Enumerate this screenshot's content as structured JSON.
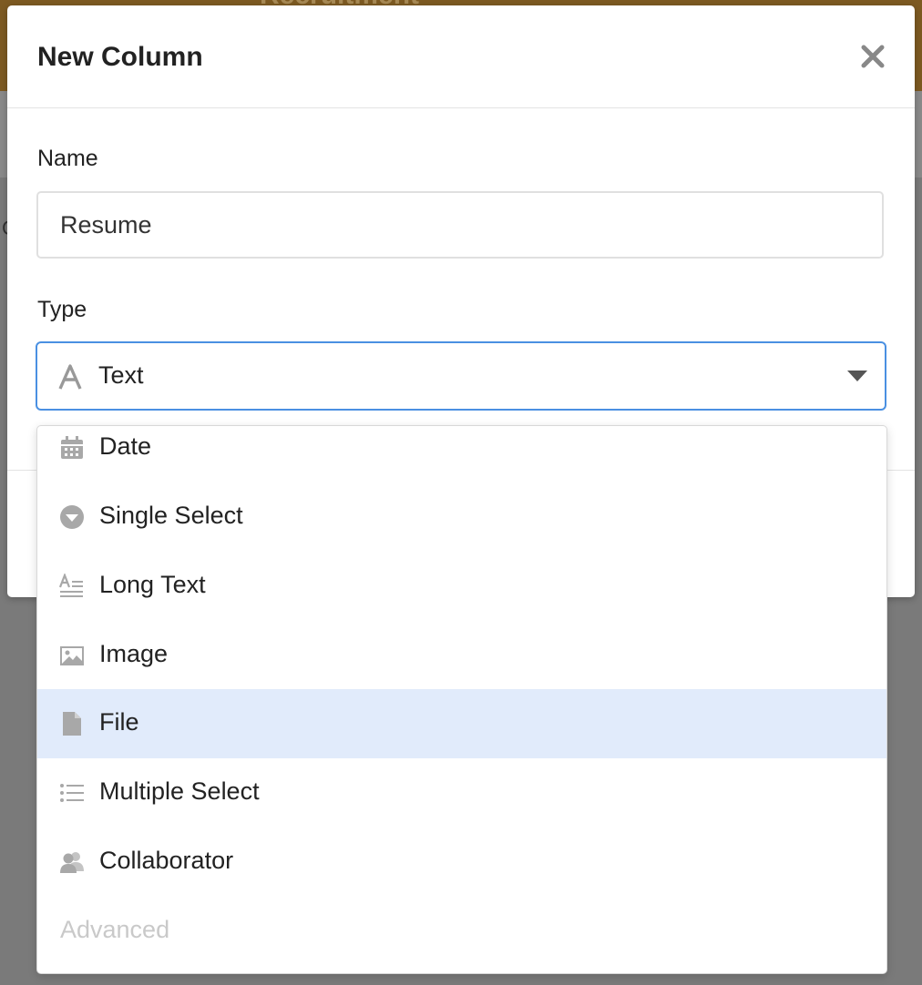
{
  "background": {
    "title_fragment": "Recruitment",
    "letter": "C"
  },
  "modal": {
    "title": "New Column",
    "close_icon": "close-icon",
    "name_label": "Name",
    "name_value": "Resume",
    "type_label": "Type",
    "type_selected": "Text",
    "type_selected_icon": "text-a-icon"
  },
  "dropdown": {
    "options": [
      {
        "label": "Date",
        "icon": "calendar-icon"
      },
      {
        "label": "Single Select",
        "icon": "circle-caret-icon"
      },
      {
        "label": "Long Text",
        "icon": "long-text-icon"
      },
      {
        "label": "Image",
        "icon": "image-icon"
      },
      {
        "label": "File",
        "icon": "file-icon"
      },
      {
        "label": "Multiple Select",
        "icon": "list-icon"
      },
      {
        "label": "Collaborator",
        "icon": "people-icon"
      }
    ],
    "highlighted": "File",
    "group_label": "Advanced"
  },
  "colors": {
    "accent": "#4a90e2",
    "highlight": "#e1ebfb",
    "header_bar": "#7d5a22",
    "icon_gray": "#a8a8a8"
  }
}
